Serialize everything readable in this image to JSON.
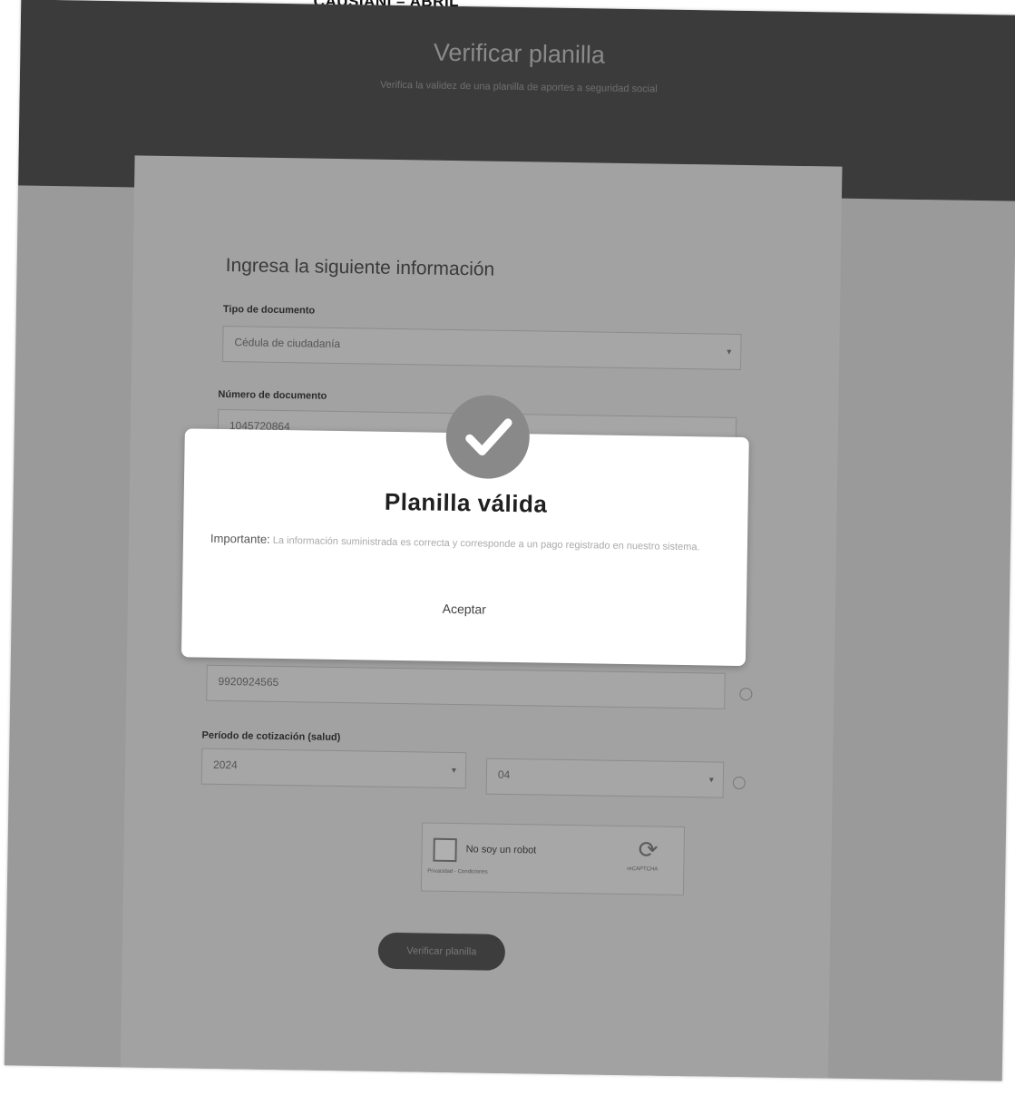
{
  "caption": "...CAUSIANI – ABRIL",
  "header": {
    "title": "Verificar planilla",
    "subtitle": "Verifica la validez de una planilla de aportes a seguridad social"
  },
  "form": {
    "heading": "Ingresa la siguiente información",
    "doc_type_label": "Tipo de documento",
    "doc_type_value": "Cédula de ciudadanía",
    "doc_number_label": "Número de documento",
    "doc_number_value": "1045720864",
    "planilla_value": "9920924565",
    "period_label": "Período de cotización (salud)",
    "period_year": "2024",
    "period_month": "04",
    "captcha_label": "No soy un robot",
    "captcha_brand": "reCAPTCHA",
    "captcha_terms": "Privacidad - Condiciones",
    "verify_button": "Verificar planilla"
  },
  "modal": {
    "title": "Planilla válida",
    "important_label": "Importante:",
    "message": "La información suministrada es correcta y corresponde a un pago registrado en nuestro sistema.",
    "accept_button": "Aceptar"
  },
  "colors": {
    "overlay": "#9a9a9a",
    "header": "#3b3b3b",
    "modal": "#ffffff",
    "success_circle": "#898989"
  }
}
